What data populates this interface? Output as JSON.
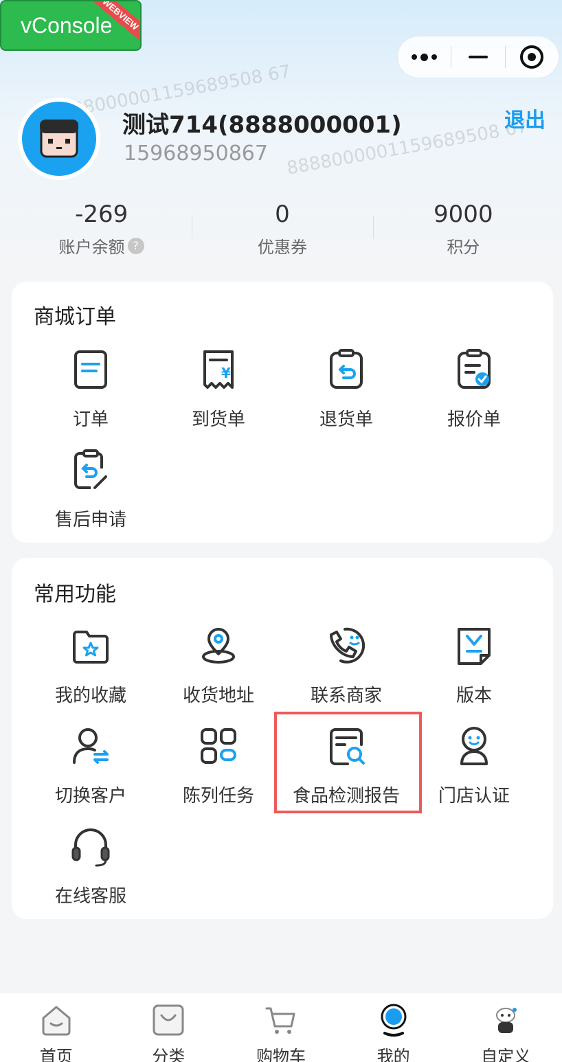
{
  "vconsole": {
    "label": "vConsole",
    "ribbon": "WEBVIEW"
  },
  "user": {
    "name": "测试714(8888000001)",
    "phone": "15968950867",
    "logout": "退出"
  },
  "stats": [
    {
      "value": "-269",
      "label": "账户余额",
      "help": "?"
    },
    {
      "value": "0",
      "label": "优惠券"
    },
    {
      "value": "9000",
      "label": "积分"
    }
  ],
  "orders": {
    "title": "商城订单",
    "items": [
      {
        "label": "订单",
        "icon": "order-list-icon"
      },
      {
        "label": "到货单",
        "icon": "receipt-yen-icon"
      },
      {
        "label": "退货单",
        "icon": "return-clipboard-icon"
      },
      {
        "label": "报价单",
        "icon": "quote-clipboard-check-icon"
      },
      {
        "label": "售后申请",
        "icon": "after-sale-edit-icon"
      }
    ]
  },
  "functions": {
    "title": "常用功能",
    "items": [
      {
        "label": "我的收藏",
        "icon": "star-folder-icon"
      },
      {
        "label": "收货地址",
        "icon": "location-pin-icon"
      },
      {
        "label": "联系商家",
        "icon": "phone-chat-icon"
      },
      {
        "label": "版本",
        "icon": "version-doc-icon"
      },
      {
        "label": "切换客户",
        "icon": "switch-user-icon"
      },
      {
        "label": "陈列任务",
        "icon": "grid-tasks-icon"
      },
      {
        "label": "食品检测报告",
        "icon": "report-search-icon"
      },
      {
        "label": "门店认证",
        "icon": "store-person-icon"
      },
      {
        "label": "在线客服",
        "icon": "headset-icon"
      }
    ]
  },
  "watermark": "8888000001159689508 67",
  "tabbar": [
    {
      "label": "首页",
      "icon": "home-icon"
    },
    {
      "label": "分类",
      "icon": "bag-icon"
    },
    {
      "label": "购物车",
      "icon": "cart-icon"
    },
    {
      "label": "我的",
      "icon": "profile-icon",
      "active": true
    },
    {
      "label": "自定义",
      "icon": "mascot-icon"
    }
  ],
  "colors": {
    "accent": "#1a9cf0",
    "highlight": "#ee5a5a",
    "vconsole": "#2dbb4f"
  }
}
